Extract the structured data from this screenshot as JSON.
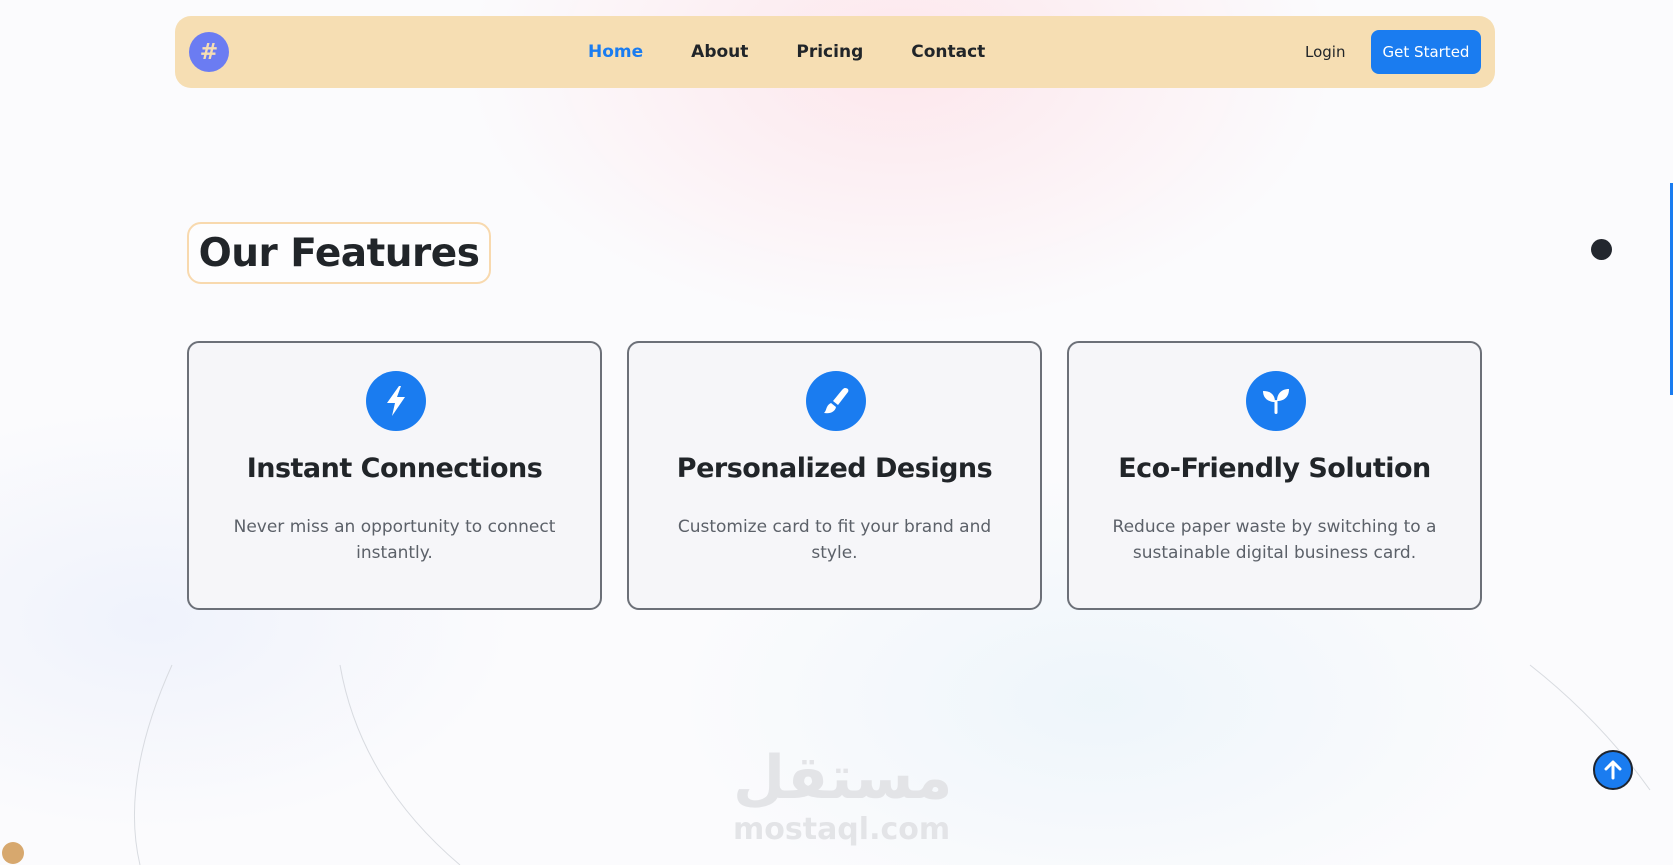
{
  "navbar": {
    "logo_glyph": "#",
    "links": [
      {
        "label": "Home",
        "active": true
      },
      {
        "label": "About",
        "active": false
      },
      {
        "label": "Pricing",
        "active": false
      },
      {
        "label": "Contact",
        "active": false
      }
    ],
    "login_label": "Login",
    "cta_label": "Get Started"
  },
  "features": {
    "title": "Our Features",
    "cards": [
      {
        "icon": "bolt-icon",
        "title": "Instant Connections",
        "description": "Never miss an opportunity to connect instantly."
      },
      {
        "icon": "paint-brush-icon",
        "title": "Personalized Designs",
        "description": "Customize card to fit your brand and style."
      },
      {
        "icon": "seedling-icon",
        "title": "Eco-Friendly Solution",
        "description": "Reduce paper waste by switching to a sustainable digital business card."
      }
    ]
  },
  "watermark": {
    "arabic": "مستقل",
    "latin": "mostaql.com"
  },
  "colors": {
    "accent": "#1a7cf0",
    "navbar_bg": "#f6deb3",
    "logo_bg": "#6b7cf2",
    "text_dark": "#212529",
    "text_muted": "#5c6169"
  }
}
